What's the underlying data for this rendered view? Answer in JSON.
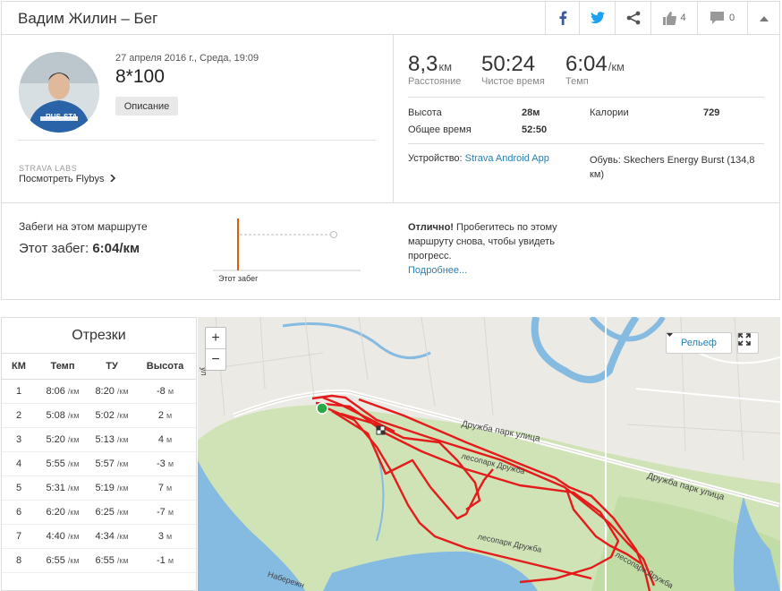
{
  "header": {
    "title": "Вадим Жилин – Бег",
    "kudos_count": "4",
    "comments_count": "0"
  },
  "activity": {
    "date": "27 апреля 2016 г., Среда, 19:09",
    "name": "8*100",
    "description_button": "Описание",
    "labs_label": "STRAVA LABS",
    "flyby_link": "Посмотреть Flybys"
  },
  "stats": {
    "distance": {
      "value": "8,3",
      "unit": "км",
      "label": "Расстояние"
    },
    "moving_time": {
      "value": "50:24",
      "label": "Чистое время"
    },
    "pace": {
      "value": "6:04",
      "unit": "/км",
      "label": "Темп"
    },
    "elevation_label": "Высота",
    "elevation_value": "28м",
    "elapsed_label": "Общее время",
    "elapsed_value": "52:50",
    "calories_label": "Калории",
    "calories_value": "729",
    "device_label": "Устройство:",
    "device_value": "Strava Android App",
    "shoes_text": "Обувь: Skechers Energy Burst (134,8 км)"
  },
  "route": {
    "title": "Забеги на этом маршруте",
    "this_run_label": "Этот забег:",
    "this_run_value": "6:04/км",
    "graph_label": "Этот забег",
    "great_bold": "Отлично!",
    "great_text": "Пробегитесь по этому маршруту снова, чтобы увидеть прогресс.",
    "more_link": "Подробнее..."
  },
  "splits": {
    "title": "Отрезки",
    "headers": [
      "КМ",
      "Темп",
      "ТУ",
      "Высота"
    ],
    "rows": [
      {
        "km": "1",
        "pace": "8:06",
        "gap": "8:20",
        "elev": "-8"
      },
      {
        "km": "2",
        "pace": "5:08",
        "gap": "5:02",
        "elev": "2"
      },
      {
        "km": "3",
        "pace": "5:20",
        "gap": "5:13",
        "elev": "4"
      },
      {
        "km": "4",
        "pace": "5:55",
        "gap": "5:57",
        "elev": "-3"
      },
      {
        "km": "5",
        "pace": "5:31",
        "gap": "5:19",
        "elev": "7"
      },
      {
        "km": "6",
        "pace": "6:20",
        "gap": "6:25",
        "elev": "-7"
      },
      {
        "km": "7",
        "pace": "4:40",
        "gap": "4:34",
        "elev": "3"
      },
      {
        "km": "8",
        "pace": "6:55",
        "gap": "6:55",
        "elev": "-1"
      }
    ],
    "pace_unit": "/км",
    "elev_unit": "м"
  },
  "map": {
    "zoom_in": "+",
    "zoom_out": "−",
    "relief_label": "Рельеф",
    "street_1": "Дружба парк улица",
    "street_2": "Дружба парк улица",
    "park_1": "лесопарк Дружба",
    "park_2": "лесопарк Дружба",
    "park_3": "лесопарк Дружба",
    "street_3": "Набережн",
    "street_4": "ул"
  },
  "colors": {
    "route": "#e31b1b",
    "water": "#7eb6de",
    "park": "#c9dfae",
    "link": "#2b7fb0",
    "marker": "#28a745"
  }
}
